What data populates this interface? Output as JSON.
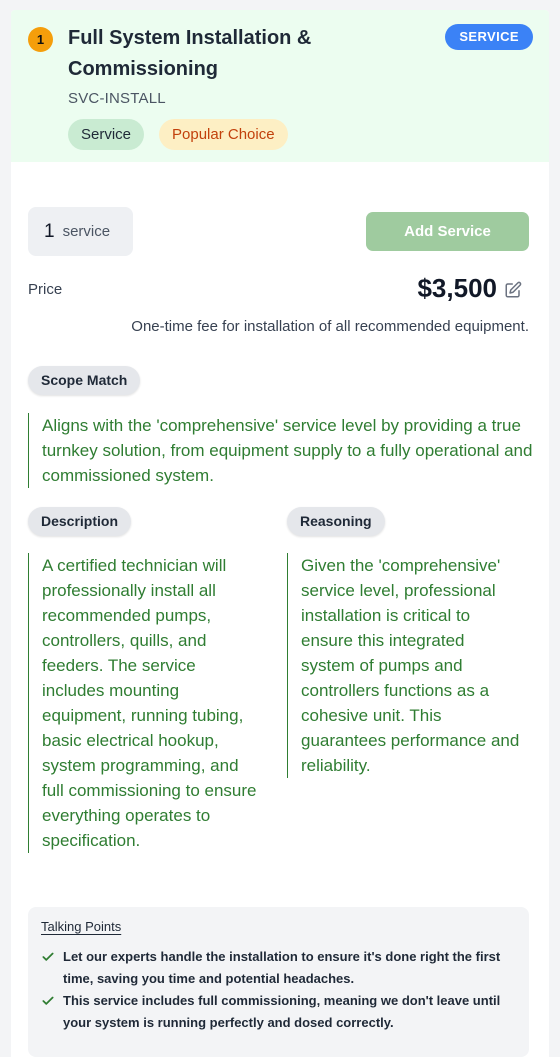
{
  "header": {
    "rank": "1",
    "title": "Full System Installation & Commissioning",
    "code": "SVC-INSTALL",
    "tags": [
      "Service",
      "Popular Choice"
    ],
    "type_badge": "SERVICE"
  },
  "order": {
    "quantity": "1",
    "unit": "service",
    "add_button": "Add Service"
  },
  "price": {
    "label": "Price",
    "value": "$3,500",
    "note": "One-time fee for installation of all recommended equipment."
  },
  "scope": {
    "label": "Scope Match",
    "text": "Aligns with the 'comprehensive' service level by providing a true turnkey solution, from equipment supply to a fully operational and commissioned system."
  },
  "description": {
    "label": "Description",
    "text": "A certified technician will professionally install all recommended pumps, controllers, quills, and feeders. The service includes mounting equipment, running tubing, basic electrical hookup, system programming, and full commissioning to ensure everything operates to specification."
  },
  "reasoning": {
    "label": "Reasoning",
    "text": "Given the 'comprehensive' service level, professional installation is critical to ensure this integrated system of pumps and controllers functions as a cohesive unit. This guarantees performance and reliability."
  },
  "talking_points": {
    "title": "Talking Points",
    "items": [
      "Let our experts handle the installation to ensure it's done right the first time, saving you time and potential headaches.",
      "This service includes full commissioning, meaning we don't leave until your system is running perfectly and dosed correctly."
    ]
  },
  "colors": {
    "header_bg": "#ecfdf0",
    "accent_green": "#2f7d32",
    "badge_blue": "#3b82f6",
    "rank_orange": "#f59e0b",
    "add_button_bg": "#9fcb9f"
  },
  "icons": [
    "edit-icon",
    "check-icon"
  ]
}
